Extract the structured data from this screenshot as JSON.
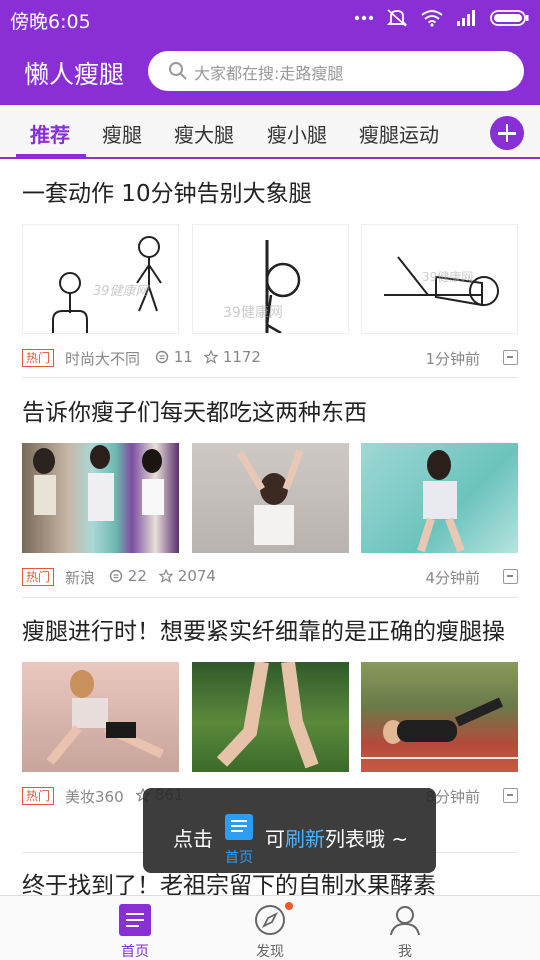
{
  "status_bar": {
    "time": "傍晚6:05",
    "icons": [
      "more-dots-icon",
      "mute-icon",
      "wifi-icon",
      "signal-icon",
      "battery-icon"
    ]
  },
  "app": {
    "title": "懒人瘦腿",
    "search_placeholder": "大家都在搜:走路瘦腿"
  },
  "tabs": [
    "推荐",
    "瘦腿",
    "瘦大腿",
    "瘦小腿",
    "瘦腿运动"
  ],
  "active_tab": "推荐",
  "articles": [
    {
      "title": "一套动作 10分钟告别大象腿",
      "hot": "热门",
      "source": "时尚大不同",
      "comments": "11",
      "stars": "1172",
      "time": "1分钟前"
    },
    {
      "title": "告诉你瘦子们每天都吃这两种东西",
      "hot": "热门",
      "source": "新浪",
      "comments": "22",
      "stars": "2074",
      "time": "4分钟前"
    },
    {
      "title": "瘦腿进行时！想要紧实纤细靠的是正确的瘦腿操",
      "hot": "热门",
      "source": "美妆360",
      "comments": "",
      "stars": "861",
      "time": "8分钟前"
    },
    {
      "title": "终于找到了！老祖宗留下的自制水果酵素"
    }
  ],
  "toast": {
    "prefix": "点击",
    "icon_label": "首页",
    "middle": "可",
    "highlight": "刷新",
    "suffix": "列表哦 ~"
  },
  "bottom_nav": [
    {
      "label": "首页",
      "icon": "home-list-icon",
      "active": true
    },
    {
      "label": "发现",
      "icon": "compass-icon",
      "active": false,
      "badge": true
    },
    {
      "label": "我",
      "icon": "user-icon",
      "active": false
    }
  ],
  "colors": {
    "brand": "#8a2fd6",
    "hot": "#e05a3a",
    "toast_highlight": "#4fb2ff"
  }
}
